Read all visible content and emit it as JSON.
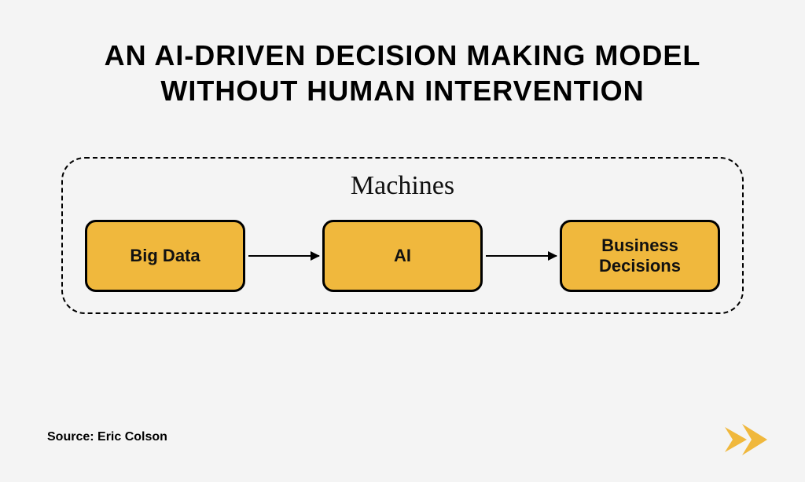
{
  "title_line1": "AN AI-DRIVEN DECISION MAKING MODEL",
  "title_line2": "WITHOUT HUMAN INTERVENTION",
  "frame_label": "Machines",
  "nodes": {
    "n1": "Big Data",
    "n2": "AI",
    "n3": "Business Decisions"
  },
  "source_text": "Source: Eric Colson",
  "colors": {
    "node_fill": "#f0b83d",
    "brand": "#f0b83d"
  }
}
